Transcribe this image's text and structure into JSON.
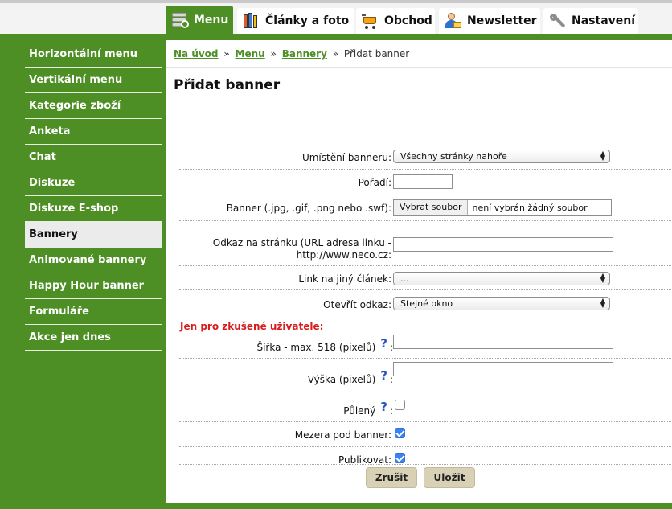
{
  "top_tabs": [
    {
      "label": "Menu",
      "icon": "menu-icon",
      "active": true
    },
    {
      "label": "Články a foto",
      "icon": "books-icon"
    },
    {
      "label": "Obchod",
      "icon": "cart-icon"
    },
    {
      "label": "Newsletter",
      "icon": "newsletter-icon"
    },
    {
      "label": "Nastavení",
      "icon": "tools-icon"
    }
  ],
  "sidebar": {
    "items": [
      {
        "label": "Horizontální menu"
      },
      {
        "label": "Vertikální menu"
      },
      {
        "label": "Kategorie zboží"
      },
      {
        "label": "Anketa"
      },
      {
        "label": "Chat"
      },
      {
        "label": "Diskuze"
      },
      {
        "label": "Diskuze E-shop"
      },
      {
        "label": "Bannery",
        "active": true
      },
      {
        "label": "Animované bannery"
      },
      {
        "label": "Happy Hour banner"
      },
      {
        "label": "Formuláře"
      },
      {
        "label": "Akce jen dnes"
      }
    ]
  },
  "breadcrumb": {
    "home": "Na úvod",
    "menu": "Menu",
    "bannery": "Bannery",
    "separator": "»",
    "current": "Přidat banner"
  },
  "page_title": "Přidat banner",
  "form": {
    "placement": {
      "label": "Umístění banneru:",
      "value": "Všechny stránky nahoře"
    },
    "order": {
      "label": "Pořadí:",
      "value": ""
    },
    "banner_file": {
      "label": "Banner (.jpg, .gif, .png nebo .swf):",
      "button": "Vybrat soubor",
      "status": "není vybrán žádný soubor"
    },
    "link_url": {
      "label_line1": "Odkaz na stránku (URL adresa linku -",
      "label_line2": "http://www.neco.cz:",
      "value": ""
    },
    "link_article": {
      "label": "Link na jiný článek:",
      "value": "..."
    },
    "open_link": {
      "label": "Otevřít odkaz:",
      "value": "Stejné okno"
    },
    "expert_heading": "Jen pro zkušené uživatele:",
    "width": {
      "label": "Šířka - max. 518 (pixelů)",
      "help": "?",
      "colon": ":",
      "value": ""
    },
    "height": {
      "label": "Výška (pixelů)",
      "help": "?",
      "colon": ":",
      "value": ""
    },
    "split": {
      "label": "Půlený",
      "help": "?",
      "colon": ":",
      "checked": false
    },
    "gap": {
      "label": "Mezera pod banner:",
      "checked": true
    },
    "publish": {
      "label": "Publikovat:",
      "checked": true
    },
    "cancel_label": "Zrušit",
    "save_label": "Uložit"
  },
  "colors": {
    "brand_green": "#4d8f25",
    "alert_red": "#d81d1d",
    "help_blue": "#2a56c4",
    "button_beige": "#d9d1b6",
    "checkbox_blue": "#3b82f6"
  }
}
